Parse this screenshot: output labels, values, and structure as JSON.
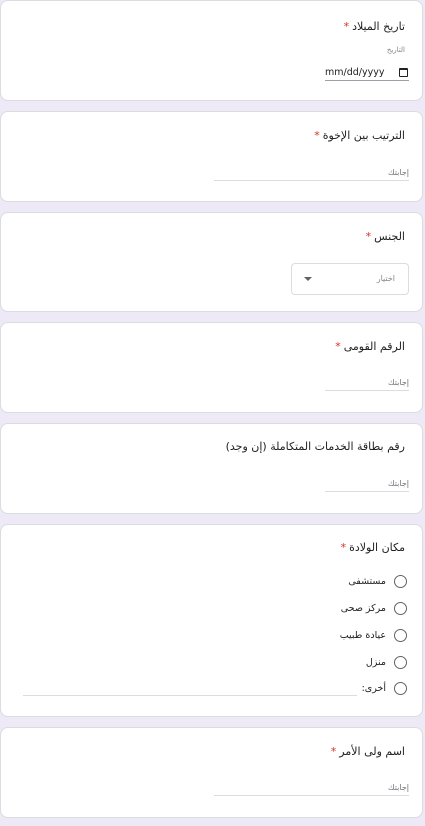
{
  "birth_date": {
    "title": "تاريخ الميلاد",
    "required_mark": "*",
    "hint": "التاريخ",
    "placeholder": "mm/dd/yyyy",
    "icon": "calendar-icon"
  },
  "sibling_order": {
    "title": "الترتيب بين الإخوة",
    "required_mark": "*",
    "answer_placeholder": "إجابتك"
  },
  "gender": {
    "title": "الجنس",
    "required_mark": "*",
    "select_placeholder": "اختيار",
    "icon": "dropdown-arrow-icon"
  },
  "national_id": {
    "title": "الرقم القومى",
    "required_mark": "*",
    "answer_placeholder": "إجابتك"
  },
  "services_card": {
    "title": "رقم بطاقة الخدمات المتكاملة (إن وجد)",
    "answer_placeholder": "إجابتك"
  },
  "birth_place": {
    "title": "مكان الولادة",
    "required_mark": "*",
    "options": [
      "مستشفى",
      "مركز صحى",
      "عيادة طبيب",
      "منزل"
    ],
    "other_label": "أخرى:"
  },
  "guardian_name": {
    "title": "اسم ولى الأمر",
    "required_mark": "*",
    "answer_placeholder": "إجابتك"
  },
  "colors": {
    "background": "#ede9f7",
    "required": "#d93025",
    "card_border": "#dadce0"
  }
}
